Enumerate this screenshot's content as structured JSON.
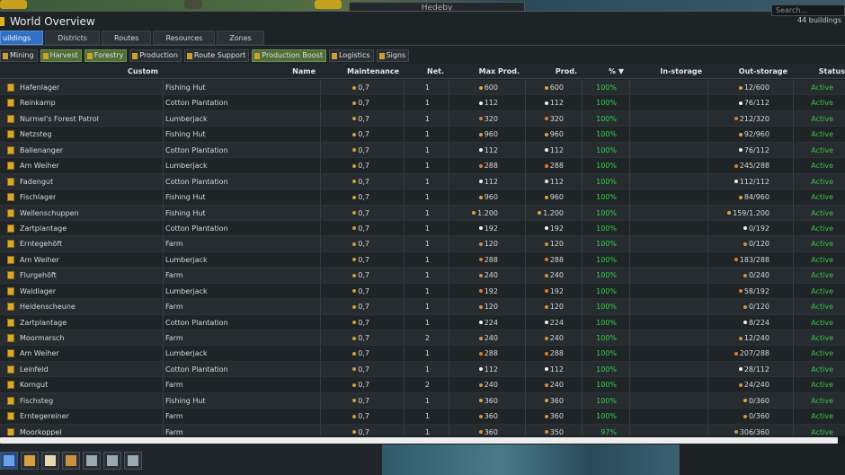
{
  "window": {
    "title": "World Overview",
    "top_label": "Hedeby",
    "search_placeholder": "Search...",
    "count": "44 buildings"
  },
  "tabs": [
    {
      "label": "uildings",
      "active": true
    },
    {
      "label": "Districts",
      "active": false
    },
    {
      "label": "Routes",
      "active": false
    },
    {
      "label": "Resources",
      "active": false
    },
    {
      "label": "Zones",
      "active": false
    }
  ],
  "filters": [
    {
      "label": "Mining",
      "on": false
    },
    {
      "label": "Harvest",
      "on": true
    },
    {
      "label": "Forestry",
      "on": true
    },
    {
      "label": "Production",
      "on": false
    },
    {
      "label": "Route Support",
      "on": false
    },
    {
      "label": "Production Boost",
      "on": true
    },
    {
      "label": "Logistics",
      "on": false
    },
    {
      "label": "Signs",
      "on": false
    }
  ],
  "columns": {
    "custom": "Custom",
    "name": "Name",
    "maintenance": "Maintenance",
    "net": "Net.",
    "max_prod": "Max Prod.",
    "prod": "Prod.",
    "pct": "% ▼",
    "in_storage": "In-storage",
    "out_storage": "Out-storage",
    "status": "Status"
  },
  "colors": {
    "accent": "#2f6fc4",
    "active_green": "#3bc24a",
    "percent_green": "#33d24a",
    "filter_on": "#4f6e3a"
  },
  "rows": [
    {
      "custom": "Hafenlager",
      "name": "Fishing Hut",
      "maint": "0,7",
      "net": "1",
      "max": "600",
      "prod": "600",
      "pct": "100%",
      "out": "12/600",
      "status": "Active",
      "res": "fish"
    },
    {
      "custom": "Reinkamp",
      "name": "Cotton Plantation",
      "maint": "0,7",
      "net": "1",
      "max": "112",
      "prod": "112",
      "pct": "100%",
      "out": "76/112",
      "status": "Active",
      "res": "cot"
    },
    {
      "custom": "Nurmel's Forest Patrol",
      "name": "Lumberjack",
      "maint": "0,7",
      "net": "1",
      "max": "320",
      "prod": "320",
      "pct": "100%",
      "out": "212/320",
      "status": "Active",
      "res": "wood"
    },
    {
      "custom": "Netzsteg",
      "name": "Fishing Hut",
      "maint": "0,7",
      "net": "1",
      "max": "960",
      "prod": "960",
      "pct": "100%",
      "out": "92/960",
      "status": "Active",
      "res": "fish"
    },
    {
      "custom": "Ballenanger",
      "name": "Cotton Plantation",
      "maint": "0,7",
      "net": "1",
      "max": "112",
      "prod": "112",
      "pct": "100%",
      "out": "76/112",
      "status": "Active",
      "res": "cot"
    },
    {
      "custom": "Am Weiher",
      "name": "Lumberjack",
      "maint": "0,7",
      "net": "1",
      "max": "288",
      "prod": "288",
      "pct": "100%",
      "out": "245/288",
      "status": "Active",
      "res": "wood"
    },
    {
      "custom": "Fadengut",
      "name": "Cotton Plantation",
      "maint": "0,7",
      "net": "1",
      "max": "112",
      "prod": "112",
      "pct": "100%",
      "out": "112/112",
      "status": "Active",
      "res": "cot"
    },
    {
      "custom": "Fischlager",
      "name": "Fishing Hut",
      "maint": "0,7",
      "net": "1",
      "max": "960",
      "prod": "960",
      "pct": "100%",
      "out": "84/960",
      "status": "Active",
      "res": "fish"
    },
    {
      "custom": "Wellenschuppen",
      "name": "Fishing Hut",
      "maint": "0,7",
      "net": "1",
      "max": "1.200",
      "prod": "1.200",
      "pct": "100%",
      "out": "159/1.200",
      "status": "Active",
      "res": "fish"
    },
    {
      "custom": "Zartplantage",
      "name": "Cotton Plantation",
      "maint": "0,7",
      "net": "1",
      "max": "192",
      "prod": "192",
      "pct": "100%",
      "out": "0/192",
      "status": "Active",
      "res": "cot"
    },
    {
      "custom": "Erntegehöft",
      "name": "Farm",
      "maint": "0,7",
      "net": "1",
      "max": "120",
      "prod": "120",
      "pct": "100%",
      "out": "0/120",
      "status": "Active",
      "res": "farm"
    },
    {
      "custom": "Am Weiher",
      "name": "Lumberjack",
      "maint": "0,7",
      "net": "1",
      "max": "288",
      "prod": "288",
      "pct": "100%",
      "out": "183/288",
      "status": "Active",
      "res": "wood"
    },
    {
      "custom": "Flurgehöft",
      "name": "Farm",
      "maint": "0,7",
      "net": "1",
      "max": "240",
      "prod": "240",
      "pct": "100%",
      "out": "0/240",
      "status": "Active",
      "res": "farm"
    },
    {
      "custom": "Waldlager",
      "name": "Lumberjack",
      "maint": "0,7",
      "net": "1",
      "max": "192",
      "prod": "192",
      "pct": "100%",
      "out": "58/192",
      "status": "Active",
      "res": "wood"
    },
    {
      "custom": "Heidenscheune",
      "name": "Farm",
      "maint": "0,7",
      "net": "1",
      "max": "120",
      "prod": "120",
      "pct": "100%",
      "out": "0/120",
      "status": "Active",
      "res": "farm"
    },
    {
      "custom": "Zartplantage",
      "name": "Cotton Plantation",
      "maint": "0,7",
      "net": "1",
      "max": "224",
      "prod": "224",
      "pct": "100%",
      "out": "8/224",
      "status": "Active",
      "res": "cot"
    },
    {
      "custom": "Moormarsch",
      "name": "Farm",
      "maint": "0,7",
      "net": "2",
      "max": "240",
      "prod": "240",
      "pct": "100%",
      "out": "12/240",
      "status": "Active",
      "res": "farm"
    },
    {
      "custom": "Am Weiher",
      "name": "Lumberjack",
      "maint": "0,7",
      "net": "1",
      "max": "288",
      "prod": "288",
      "pct": "100%",
      "out": "207/288",
      "status": "Active",
      "res": "wood"
    },
    {
      "custom": "Leinfeld",
      "name": "Cotton Plantation",
      "maint": "0,7",
      "net": "1",
      "max": "112",
      "prod": "112",
      "pct": "100%",
      "out": "28/112",
      "status": "Active",
      "res": "cot"
    },
    {
      "custom": "Korngut",
      "name": "Farm",
      "maint": "0,7",
      "net": "2",
      "max": "240",
      "prod": "240",
      "pct": "100%",
      "out": "24/240",
      "status": "Active",
      "res": "farm"
    },
    {
      "custom": "Fischsteg",
      "name": "Fishing Hut",
      "maint": "0,7",
      "net": "1",
      "max": "360",
      "prod": "360",
      "pct": "100%",
      "out": "0/360",
      "status": "Active",
      "res": "fish"
    },
    {
      "custom": "Erntegereiner",
      "name": "Farm",
      "maint": "0,7",
      "net": "1",
      "max": "360",
      "prod": "360",
      "pct": "100%",
      "out": "0/360",
      "status": "Active",
      "res": "farm"
    },
    {
      "custom": "Moorkoppel",
      "name": "Farm",
      "maint": "0,7",
      "net": "1",
      "max": "360",
      "prod": "350",
      "pct": "97%",
      "out": "306/360",
      "status": "Active",
      "res": "farm"
    }
  ],
  "taskbar": [
    {
      "icon": "home-icon"
    },
    {
      "icon": "document-icon"
    },
    {
      "icon": "mail-icon"
    },
    {
      "icon": "map-icon"
    },
    {
      "icon": "stats-icon"
    },
    {
      "icon": "table-icon"
    },
    {
      "icon": "grid-icon"
    }
  ]
}
